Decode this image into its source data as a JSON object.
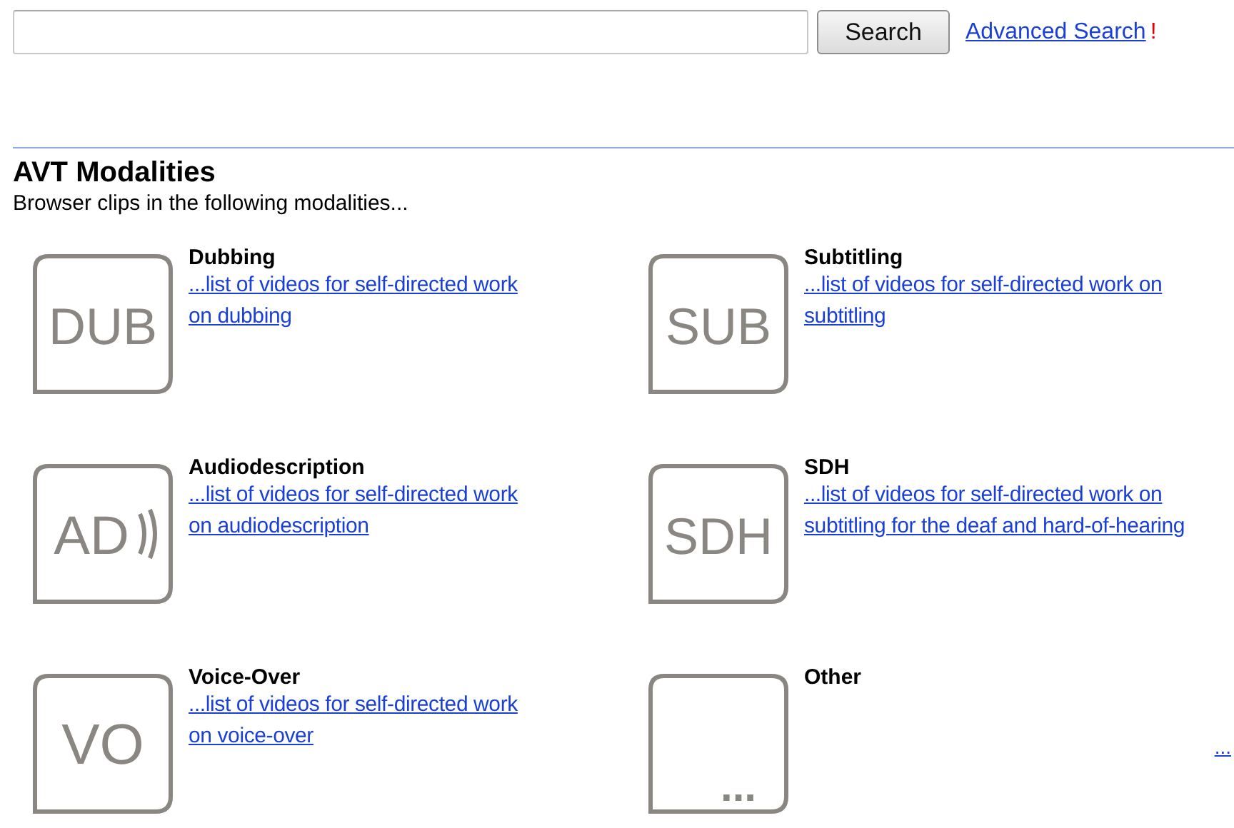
{
  "search": {
    "button": "Search",
    "advanced_link": "Advanced Search",
    "alert_mark": "!"
  },
  "section": {
    "title": "AVT Modalities",
    "subtitle": "Browser clips in the following modalities..."
  },
  "modalities": [
    {
      "title": "Dubbing",
      "link": "...list of videos for self-directed work on dubbing",
      "icon": {
        "kind": "label",
        "label": "DUB"
      }
    },
    {
      "title": "Subtitling",
      "link": "...list of videos for self-directed work on subtitling",
      "icon": {
        "kind": "label",
        "label": "SUB"
      }
    },
    {
      "title": "Audiodescription",
      "link": "...list of videos for self-directed work on audiodescription",
      "icon": {
        "kind": "audio",
        "label": "AD"
      }
    },
    {
      "title": "SDH",
      "link": "...list of videos for self-directed work on subtitling for the deaf and hard-of-hearing",
      "icon": {
        "kind": "label",
        "label": "SDH"
      }
    },
    {
      "title": "Voice-Over",
      "link": "...list of videos for self-directed work on voice-over",
      "icon": {
        "kind": "label",
        "label": "VO"
      }
    },
    {
      "title": "Other",
      "icon": {
        "kind": "more",
        "label": "..."
      }
    }
  ],
  "more_link": "..."
}
